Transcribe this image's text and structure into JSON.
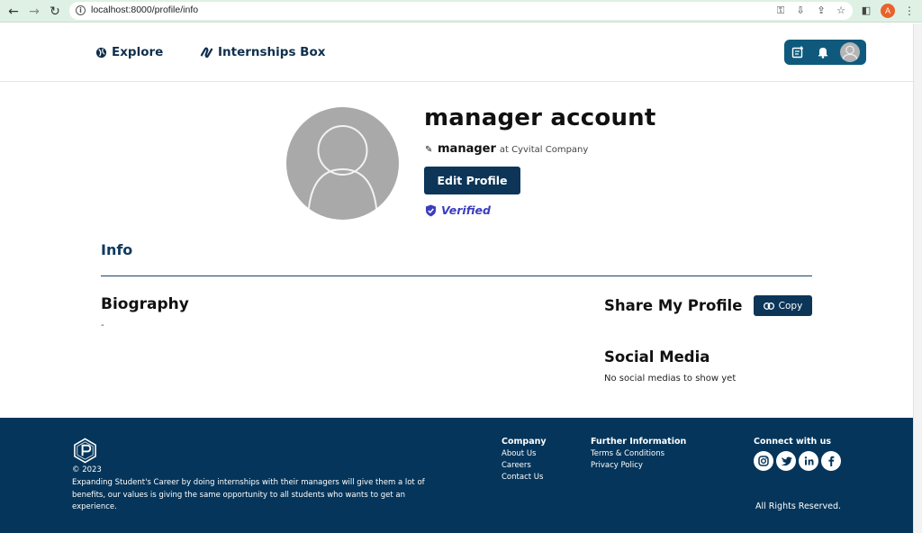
{
  "browser": {
    "url": "localhost:8000/profile/info",
    "profile_initial": "A"
  },
  "header": {
    "nav": [
      {
        "label": "Explore",
        "icon": "globe-icon"
      },
      {
        "label": "Internships Box",
        "icon": "infinity-logo-icon"
      }
    ],
    "actions": [
      "new-post-icon",
      "bell-icon",
      "user-avatar"
    ],
    "accent": "#0f5a7c"
  },
  "profile": {
    "name": "manager account",
    "role": "manager",
    "company": "at Cyvital Company",
    "edit_label": "Edit Profile",
    "verified_label": "Verified"
  },
  "tabs": {
    "active": "Info"
  },
  "biography": {
    "heading": "Biography",
    "text": "-"
  },
  "share": {
    "heading": "Share My Profile",
    "copy_label": "Copy"
  },
  "social": {
    "heading": "Social Media",
    "empty_text": "No social medias to show yet"
  },
  "footer": {
    "copyright": "© 2023",
    "mission": "Expanding Student's Career by doing internships with their managers will give them a lot of benefits, our values is giving the same opportunity to all students who wants to get an experience.",
    "company": {
      "heading": "Company",
      "links": [
        "About Us",
        "Careers",
        "Contact Us"
      ]
    },
    "further": {
      "heading": "Further Information",
      "links": [
        "Terms & Conditions",
        "Privacy Policy"
      ]
    },
    "connect": {
      "heading": "Connect with us",
      "icons": [
        "instagram-icon",
        "twitter-icon",
        "linkedin-icon",
        "facebook-icon"
      ]
    },
    "rights": "All Rights Reserved.",
    "bg": "#05355a"
  },
  "colors": {
    "primary_button": "#0c3558",
    "verified": "#3a3dbf"
  }
}
